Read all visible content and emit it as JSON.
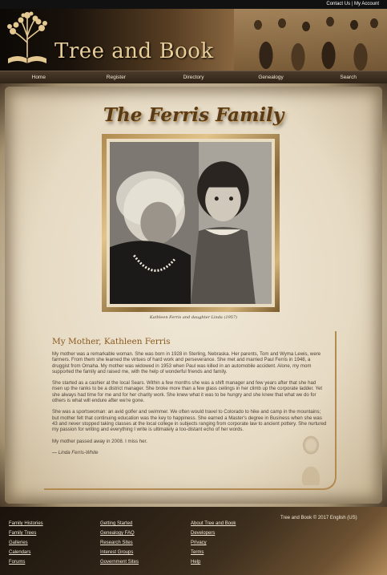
{
  "topbar": {
    "contact": "Contact Us",
    "separator": " | ",
    "account": "My Account"
  },
  "brand": {
    "name": "Tree and Book"
  },
  "nav": [
    "Home",
    "Register",
    "Directory",
    "Genealogy",
    "Search"
  ],
  "page": {
    "title": "The Ferris Family",
    "caption": "Kathleen Ferris and daughter Linda (1957)"
  },
  "article": {
    "heading": "My Mother, Kathleen Ferris",
    "paragraphs": [
      "My mother was a remarkable woman. She was born in 1928 in Sterling, Nebraska. Her parents, Tom and Wyma Lewis, were farmers. From them she learned the virtues of hard work and perseverance. She met and married Paul Ferris in 1948, a druggist from Omaha. My mother was widowed in 1953 when Paul was killed in an automobile accident. Alone, my mom supported the family and raised me, with the help of wonderful friends and family.",
      "She started as a cashier at the local Sears. Within a few months she was a shift manager and few years after that she had risen up the ranks to be a district manager. She broke more than a few glass ceilings in her climb up the corporate ladder. Yet she always had time for me and for her charity work. She knew what it was to be hungry and she knew that what we do for others is what will endure after we're gone.",
      "She was a sportswoman: an avid golfer and swimmer. We often would travel to Colorado to hike and camp in the mountains; but mother felt that continuing education was the key to happiness. She earned a Master's degree in Business when she was 43 and never stopped taking classes at the local college in subjects ranging from corporate law to ancient pottery. She nurtured my passion for writing and everything I write is ultimately a too-distant echo of her words.",
      "My mother passed away in 2008. I miss her."
    ],
    "signature": "— Linda Ferris-White"
  },
  "footer": {
    "col1": [
      "Family Histories",
      "Family Trees",
      "Galleries",
      "Calendars",
      "Forums"
    ],
    "col2": [
      "Getting Started",
      "Genealogy FAQ",
      "Research Sites",
      "Interest Groups",
      "Government Sites"
    ],
    "col3": [
      "About Tree and Book",
      "Developers",
      "Privacy",
      "Terms",
      "Help"
    ],
    "copyright": "Tree and Book © 2017 English (US)"
  }
}
